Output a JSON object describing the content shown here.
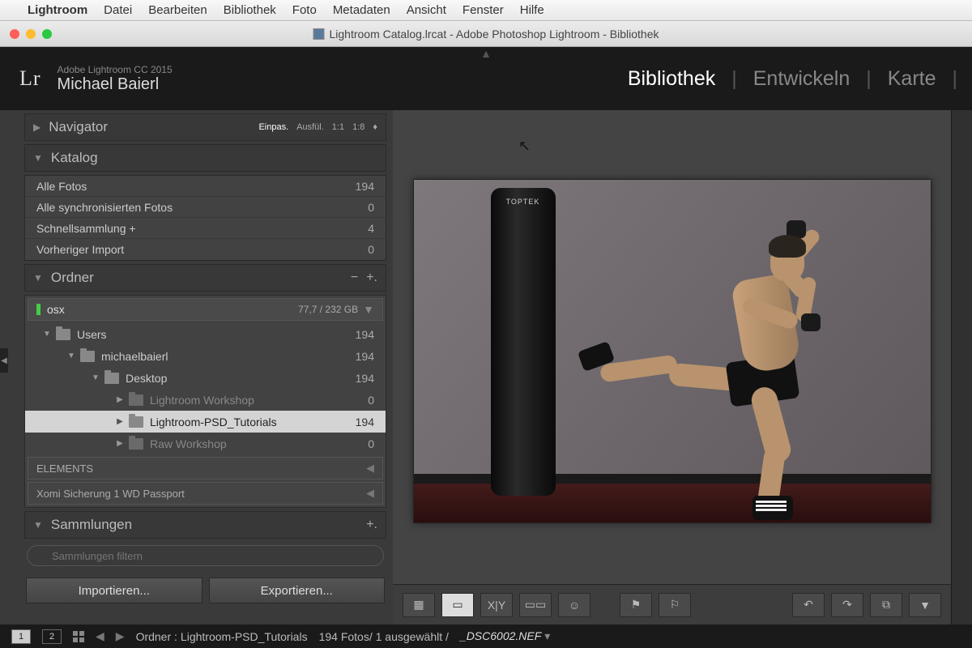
{
  "mac_menu": {
    "app": "Lightroom",
    "items": [
      "Datei",
      "Bearbeiten",
      "Bibliothek",
      "Foto",
      "Metadaten",
      "Ansicht",
      "Fenster",
      "Hilfe"
    ]
  },
  "window": {
    "title": "Lightroom Catalog.lrcat - Adobe Photoshop Lightroom - Bibliothek"
  },
  "header": {
    "logo": "Lr",
    "product": "Adobe Lightroom CC 2015",
    "user": "Michael Baierl",
    "modules": {
      "bibliothek": "Bibliothek",
      "entwickeln": "Entwickeln",
      "karte": "Karte"
    }
  },
  "navigator": {
    "title": "Navigator",
    "opts": [
      "Einpas.",
      "Ausfül.",
      "1:1",
      "1:8"
    ]
  },
  "catalog": {
    "title": "Katalog",
    "rows": [
      {
        "label": "Alle Fotos",
        "count": "194"
      },
      {
        "label": "Alle synchronisierten Fotos",
        "count": "0"
      },
      {
        "label": "Schnellsammlung  +",
        "count": "4"
      },
      {
        "label": "Vorheriger Import",
        "count": "0"
      }
    ]
  },
  "folders": {
    "title": "Ordner",
    "volume": {
      "name": "osx",
      "capacity": "77,7 / 232 GB"
    },
    "tree": [
      {
        "indent": 0,
        "open": true,
        "name": "Users",
        "count": "194"
      },
      {
        "indent": 1,
        "open": true,
        "name": "michaelbaierl",
        "count": "194"
      },
      {
        "indent": 2,
        "open": true,
        "name": "Desktop",
        "count": "194"
      },
      {
        "indent": 3,
        "open": false,
        "name": "Lightroom Workshop",
        "count": "0",
        "dim": true
      },
      {
        "indent": 3,
        "open": false,
        "name": "Lightroom-PSD_Tutorials",
        "count": "194",
        "selected": true
      },
      {
        "indent": 3,
        "open": false,
        "name": "Raw Workshop",
        "count": "0",
        "dim": true
      }
    ],
    "drives": [
      "ELEMENTS",
      "Xomi Sicherung 1 WD Passport"
    ]
  },
  "collections": {
    "title": "Sammlungen",
    "search_placeholder": "Sammlungen filtern"
  },
  "buttons": {
    "import": "Importieren...",
    "export": "Exportieren..."
  },
  "preview": {
    "bag_label": "TOPTEK"
  },
  "status": {
    "monitors": [
      "1",
      "2"
    ],
    "path_label": "Ordner :",
    "path_value": "Lightroom-PSD_Tutorials",
    "count_text": "194 Fotos/  1 ausgewählt /",
    "filename": "_DSC6002.NEF"
  }
}
